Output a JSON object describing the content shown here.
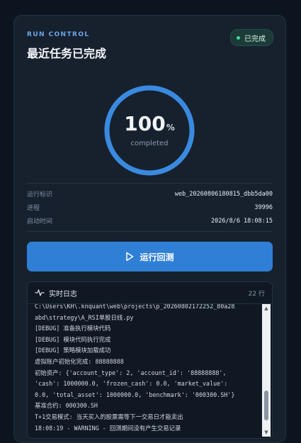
{
  "header": {
    "eyebrow": "RUN CONTROL",
    "title": "最近任务已完成",
    "status_badge": "已完成",
    "colors": {
      "status_dot": "#3ddc97",
      "accent": "#2f7fd6"
    }
  },
  "progress": {
    "percent_value": "100",
    "percent_symbol": "%",
    "fraction": 1.0,
    "label": "completed"
  },
  "meta": [
    {
      "key": "运行标识",
      "value": "web_20260806180815_dbb5da00"
    },
    {
      "key": "进程",
      "value": "39996"
    },
    {
      "key": "启动时间",
      "value": "2026/8/6 18:08:15"
    }
  ],
  "run_button": {
    "label": "运行回测",
    "icon": "play-icon"
  },
  "log": {
    "title": "实时日志",
    "icon": "activity-icon",
    "count": "22 行",
    "lines": [
      "C:\\Users\\KH\\.knquant\\web\\projects\\p_20260802172252_80a28",
      "abd\\strategy\\A_RSI单股日线.py",
      "[DEBUG] 准备执行模块代码",
      "[DEBUG] 模块代码执行完成",
      "[DEBUG] 策略模块加载成功",
      "虚拟账户初始化完成: 88888888",
      "初始资产: {'account_type': 2, 'account_id': '88888888',",
      "'cash': 1000000.0, 'frozen_cash': 0.0, 'market_value':",
      "0.0, 'total_asset': 1000000.0, 'benchmark': '000300.SH'}",
      "基准合约: 000300.SH",
      "T+1交易模式: 当天买入的股票需等下一交易日才能卖出",
      "18:08:19 - WARNING - 回测期间没有产生交易记录"
    ]
  }
}
